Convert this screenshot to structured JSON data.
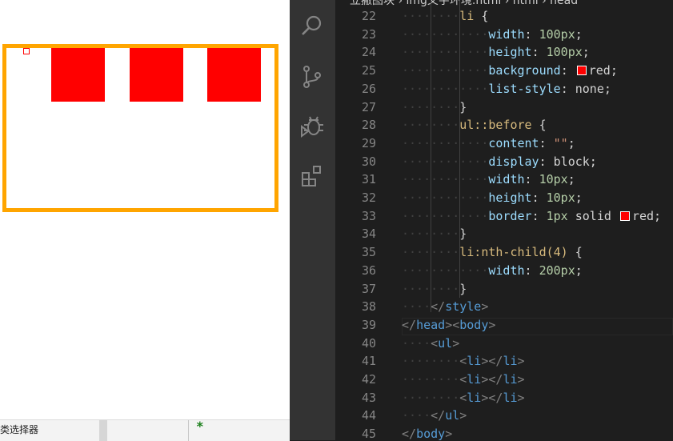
{
  "preview": {
    "list_items": 3,
    "colors": {
      "border": "#ffa500",
      "item": "#ff0000"
    },
    "bottom_text": "类选择器",
    "bottom_star": "*"
  },
  "breadcrumb": "立撇图块 › img文字环境.html › html › head",
  "activity_icons": [
    "search-icon",
    "source-control-icon",
    "debug-icon",
    "extensions-icon"
  ],
  "editor": {
    "lines": [
      {
        "n": "22",
        "ind": 2,
        "parts": [
          [
            "sel",
            "li"
          ],
          [
            "d",
            " {"
          ]
        ]
      },
      {
        "n": "23",
        "ind": 3,
        "parts": [
          [
            "prop",
            "width"
          ],
          [
            "d",
            ": "
          ],
          [
            "num",
            "100px"
          ],
          [
            "d",
            ";"
          ]
        ]
      },
      {
        "n": "24",
        "ind": 3,
        "parts": [
          [
            "prop",
            "height"
          ],
          [
            "d",
            ": "
          ],
          [
            "num",
            "100px"
          ],
          [
            "d",
            ";"
          ]
        ]
      },
      {
        "n": "25",
        "ind": 3,
        "parts": [
          [
            "prop",
            "background"
          ],
          [
            "d",
            ": "
          ],
          [
            "sw",
            ""
          ],
          [
            "d",
            "red;"
          ]
        ]
      },
      {
        "n": "26",
        "ind": 3,
        "parts": [
          [
            "prop",
            "list-style"
          ],
          [
            "d",
            ": none;"
          ]
        ]
      },
      {
        "n": "27",
        "ind": 2,
        "parts": [
          [
            "d",
            "}"
          ]
        ]
      },
      {
        "n": "28",
        "ind": 2,
        "parts": [
          [
            "sel",
            "ul::before"
          ],
          [
            "d",
            " {"
          ]
        ]
      },
      {
        "n": "29",
        "ind": 3,
        "parts": [
          [
            "prop",
            "content"
          ],
          [
            "d",
            ": "
          ],
          [
            "str",
            "\"\""
          ],
          [
            "d",
            ";"
          ]
        ]
      },
      {
        "n": "30",
        "ind": 3,
        "parts": [
          [
            "prop",
            "display"
          ],
          [
            "d",
            ": block;"
          ]
        ]
      },
      {
        "n": "31",
        "ind": 3,
        "parts": [
          [
            "prop",
            "width"
          ],
          [
            "d",
            ": "
          ],
          [
            "num",
            "10px"
          ],
          [
            "d",
            ";"
          ]
        ]
      },
      {
        "n": "32",
        "ind": 3,
        "parts": [
          [
            "prop",
            "height"
          ],
          [
            "d",
            ": "
          ],
          [
            "num",
            "10px"
          ],
          [
            "d",
            ";"
          ]
        ]
      },
      {
        "n": "33",
        "ind": 3,
        "parts": [
          [
            "prop",
            "border"
          ],
          [
            "d",
            ": "
          ],
          [
            "num",
            "1px"
          ],
          [
            "d",
            " solid "
          ],
          [
            "sw",
            ""
          ],
          [
            "d",
            "red;"
          ]
        ]
      },
      {
        "n": "34",
        "ind": 2,
        "parts": [
          [
            "d",
            "}"
          ]
        ]
      },
      {
        "n": "35",
        "ind": 2,
        "parts": [
          [
            "sel",
            "li:nth-child(4)"
          ],
          [
            "d",
            " {"
          ]
        ]
      },
      {
        "n": "36",
        "ind": 3,
        "parts": [
          [
            "prop",
            "width"
          ],
          [
            "d",
            ": "
          ],
          [
            "num",
            "200px"
          ],
          [
            "d",
            ";"
          ]
        ]
      },
      {
        "n": "37",
        "ind": 2,
        "parts": [
          [
            "d",
            "}"
          ]
        ]
      },
      {
        "n": "38",
        "ind": 1,
        "parts": [
          [
            "punc",
            "</"
          ],
          [
            "tag",
            "style"
          ],
          [
            "punc",
            ">"
          ]
        ]
      },
      {
        "n": "39",
        "ind": 0,
        "parts": [
          [
            "punc",
            "</"
          ],
          [
            "tag",
            "head"
          ],
          [
            "punc",
            ">"
          ],
          [
            "punc",
            "<"
          ],
          [
            "tag",
            "body"
          ],
          [
            "punc",
            ">"
          ]
        ]
      },
      {
        "n": "40",
        "ind": 1,
        "parts": [
          [
            "punc",
            "<"
          ],
          [
            "tag",
            "ul"
          ],
          [
            "punc",
            ">"
          ]
        ]
      },
      {
        "n": "41",
        "ind": 2,
        "parts": [
          [
            "punc",
            "<"
          ],
          [
            "tag",
            "li"
          ],
          [
            "punc",
            "></"
          ],
          [
            "tag",
            "li"
          ],
          [
            "punc",
            ">"
          ]
        ]
      },
      {
        "n": "42",
        "ind": 2,
        "parts": [
          [
            "punc",
            "<"
          ],
          [
            "tag",
            "li"
          ],
          [
            "punc",
            "></"
          ],
          [
            "tag",
            "li"
          ],
          [
            "punc",
            ">"
          ]
        ]
      },
      {
        "n": "43",
        "ind": 2,
        "parts": [
          [
            "punc",
            "<"
          ],
          [
            "tag",
            "li"
          ],
          [
            "punc",
            "></"
          ],
          [
            "tag",
            "li"
          ],
          [
            "punc",
            ">"
          ]
        ]
      },
      {
        "n": "44",
        "ind": 1,
        "parts": [
          [
            "punc",
            "</"
          ],
          [
            "tag",
            "ul"
          ],
          [
            "punc",
            ">"
          ]
        ]
      },
      {
        "n": "45",
        "ind": 0,
        "parts": [
          [
            "punc",
            "</"
          ],
          [
            "tag",
            "body"
          ],
          [
            "punc",
            ">"
          ]
        ]
      }
    ]
  }
}
